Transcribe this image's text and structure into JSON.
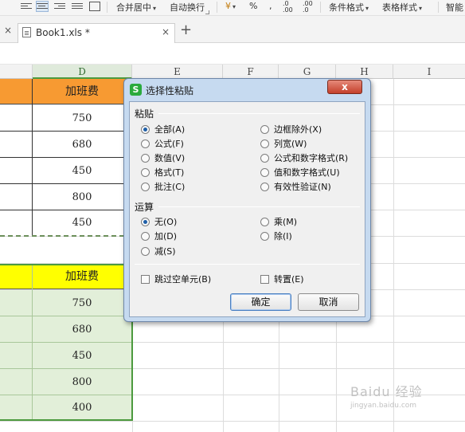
{
  "ribbon": {
    "merge_center": "合并居中",
    "auto_wrap": "自动换行",
    "percent": "%",
    "decimal_inc": ".0\n.00",
    "conditional_format": "条件格式",
    "table_style": "表格样式",
    "smart": "智能"
  },
  "tabbar": {
    "file_tab": "Book1.xls *",
    "close_icon": "×",
    "new_tab": "+"
  },
  "columns": [
    "D",
    "E",
    "F",
    "G",
    "H",
    "I"
  ],
  "sheet": {
    "top_header": "加班费",
    "top_values": [
      "750",
      "680",
      "450",
      "800",
      "450"
    ],
    "bottom_header": "加班费",
    "bottom_values": [
      "750",
      "680",
      "450",
      "800",
      "400"
    ]
  },
  "dialog": {
    "title": "选择性粘贴",
    "close": "x",
    "paste_group": "粘贴",
    "paste_options_left": [
      "全部(A)",
      "公式(F)",
      "数值(V)",
      "格式(T)",
      "批注(C)"
    ],
    "paste_options_right": [
      "边框除外(X)",
      "列宽(W)",
      "公式和数字格式(R)",
      "值和数字格式(U)",
      "有效性验证(N)"
    ],
    "paste_selected": "全部(A)",
    "operation_group": "运算",
    "op_options_left": [
      "无(O)",
      "加(D)",
      "减(S)"
    ],
    "op_options_right": [
      "乘(M)",
      "除(I)"
    ],
    "op_selected": "无(O)",
    "skip_blanks": "跳过空单元(B)",
    "transpose": "转置(E)",
    "ok": "确定",
    "cancel": "取消"
  },
  "watermark": "Baidu 经验",
  "watermark_url": "jingyan.baidu.com"
}
